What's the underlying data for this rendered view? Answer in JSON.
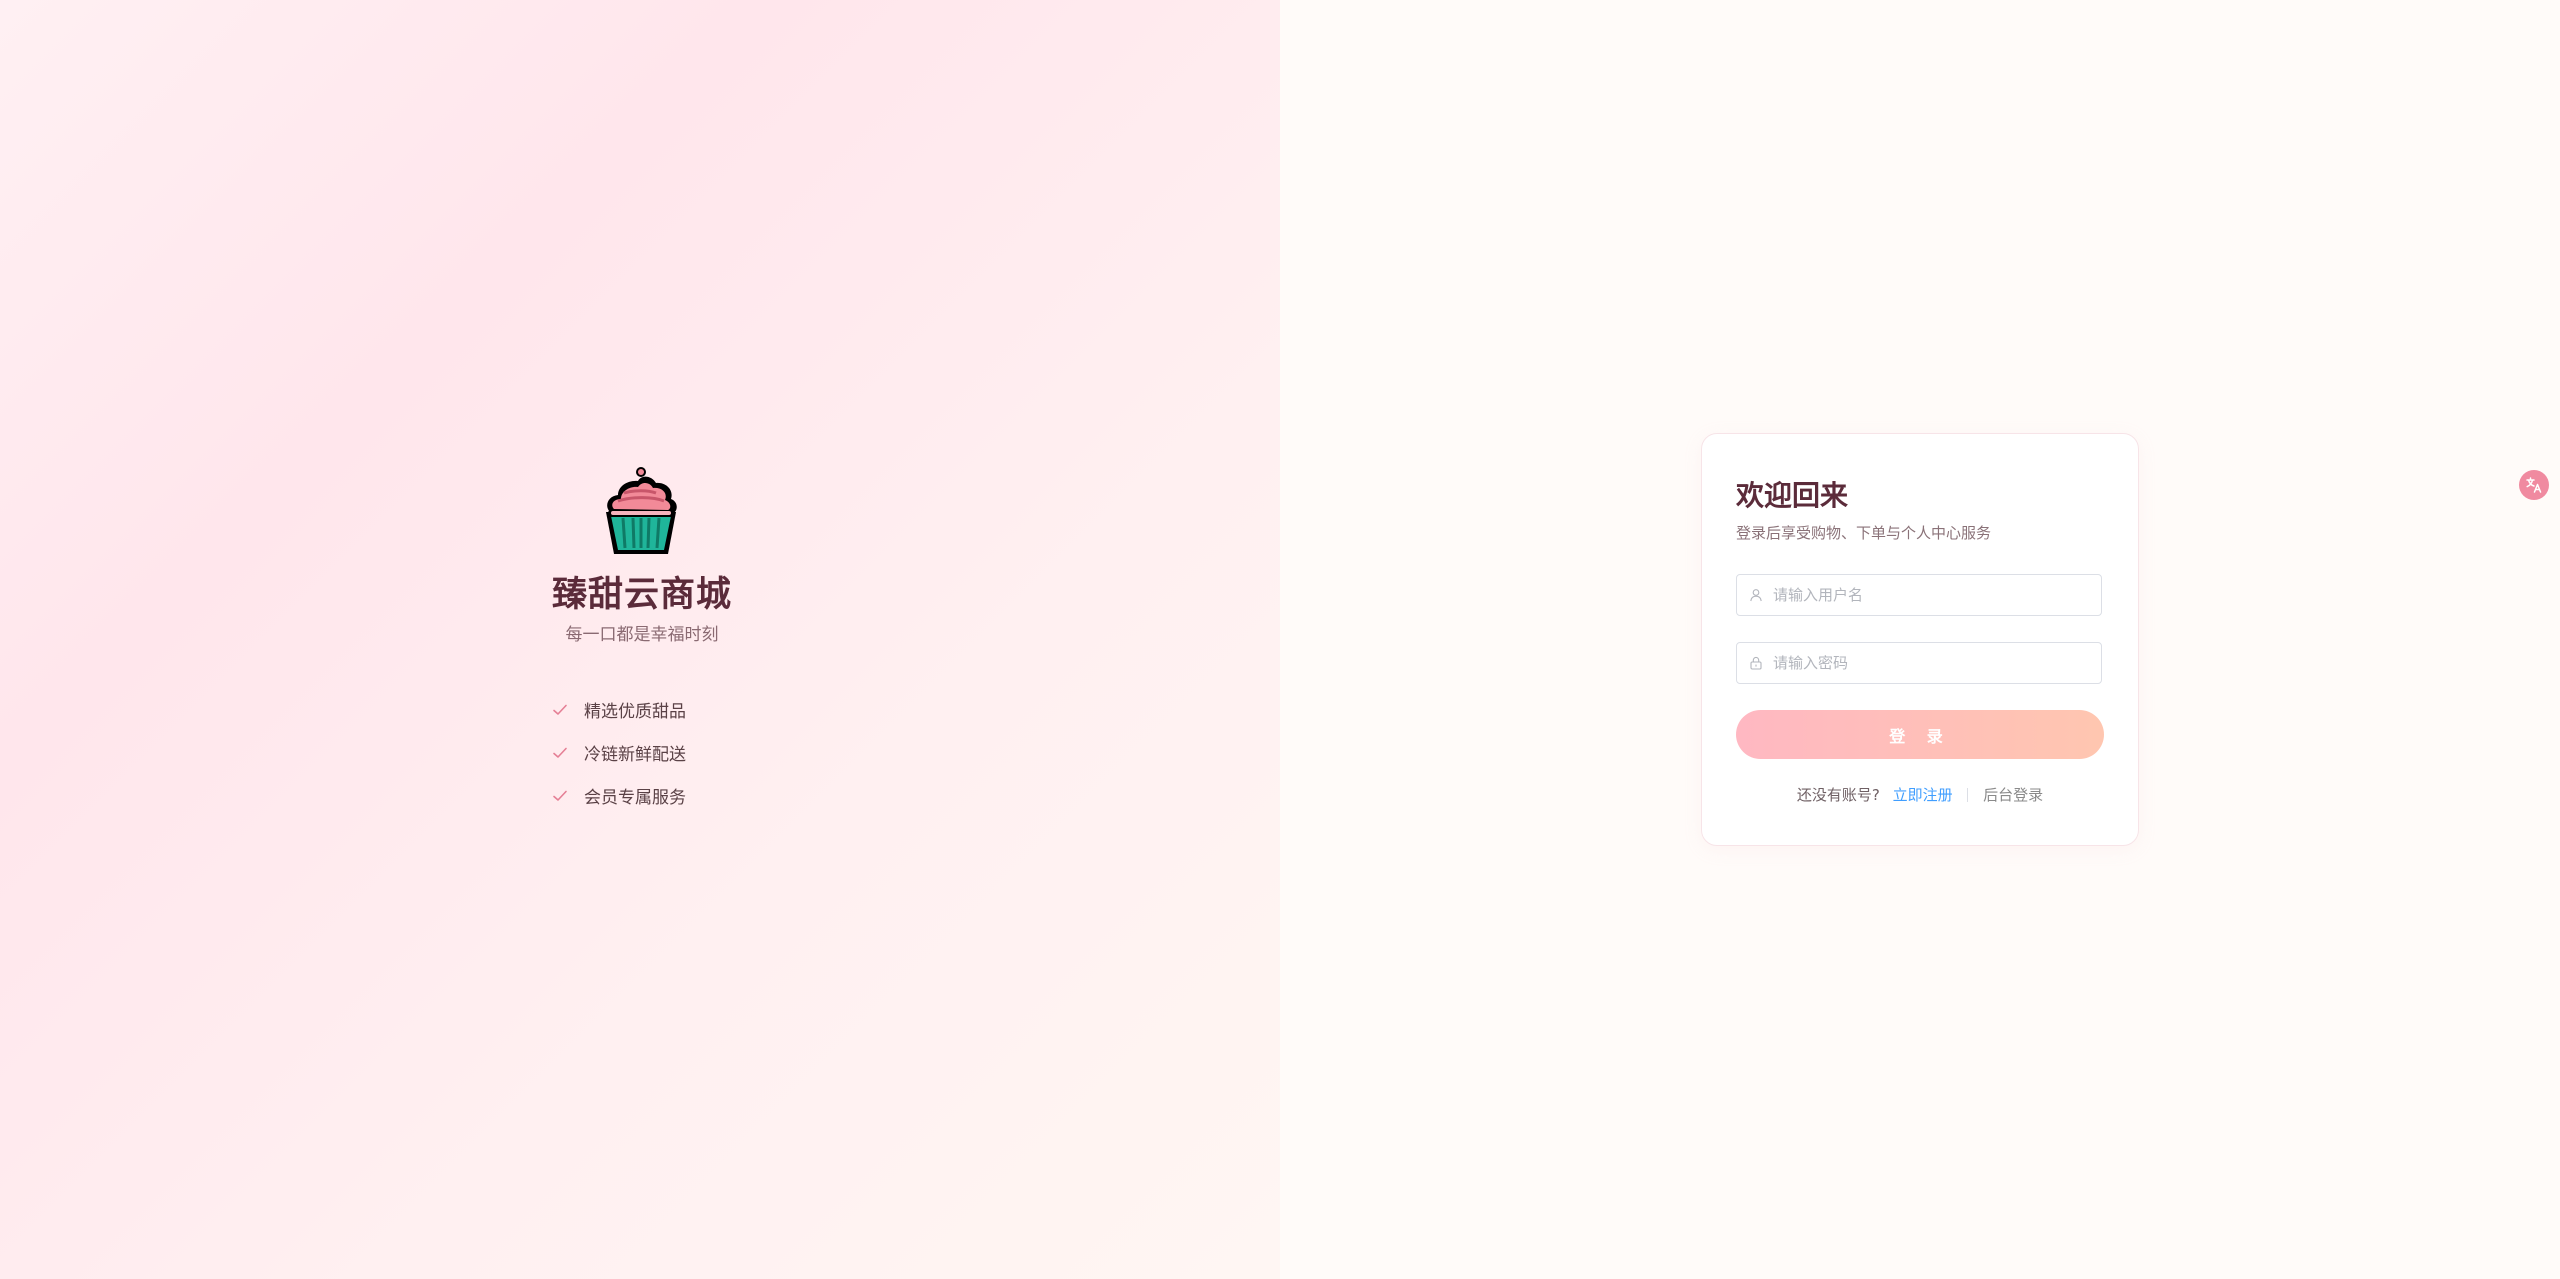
{
  "brand": {
    "logo_icon": "cupcake-icon",
    "title": "臻甜云商城",
    "slogan": "每一口都是幸福时刻",
    "features": [
      {
        "icon": "check-icon",
        "label": "精选优质甜品"
      },
      {
        "icon": "check-icon",
        "label": "冷链新鲜配送"
      },
      {
        "icon": "check-icon",
        "label": "会员专属服务"
      }
    ]
  },
  "login": {
    "title": "欢迎回来",
    "subtitle": "登录后享受购物、下单与个人中心服务",
    "username": {
      "icon": "user-icon",
      "value": "",
      "placeholder": "请输入用户名"
    },
    "password": {
      "icon": "lock-icon",
      "value": "",
      "placeholder": "请输入密码"
    },
    "submit_label": "登 录",
    "footer": {
      "no_account": "还没有账号?",
      "register_link": "立即注册",
      "admin_link": "后台登录"
    }
  },
  "floating": {
    "icon": "translate-icon"
  },
  "colors": {
    "brand_text": "#5b2b3a",
    "accent_pink": "#f08aa0",
    "button_gradient_start": "#ffb8c2",
    "button_gradient_end": "#ffc6b0",
    "link_blue": "#409eff"
  }
}
